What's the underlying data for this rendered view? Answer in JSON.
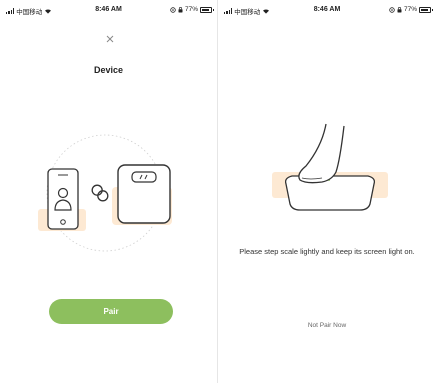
{
  "status_bar": {
    "carrier": "中国移动",
    "time": "8:46 AM",
    "battery": "77%"
  },
  "left_screen": {
    "title": "Device",
    "pair_label": "Pair",
    "icons": [
      "close-icon",
      "phone-user-icon",
      "link-icon",
      "scale-icon"
    ]
  },
  "right_screen": {
    "instruction": "Please step scale lightly and keep its screen light on.",
    "skip_label": "Not Pair Now",
    "icons": [
      "foot-on-scale-icon"
    ]
  },
  "colors": {
    "accent": "#8dbf5e",
    "highlight": "#fde9d3",
    "outline": "#333333"
  }
}
